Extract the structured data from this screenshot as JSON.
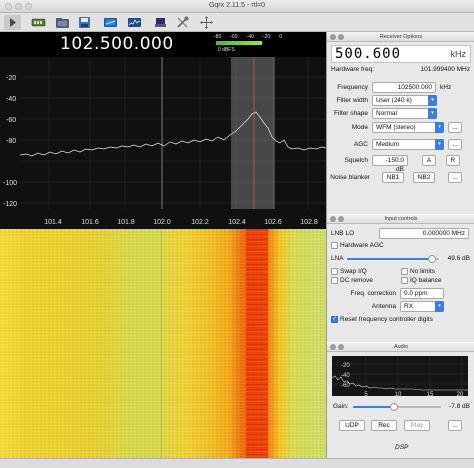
{
  "window": {
    "title": "Gqrx 2.11.5 - rtl=0"
  },
  "toolbar": {
    "icons": [
      "play-icon",
      "device-icon",
      "open-icon",
      "save-icon",
      "receiver-icon",
      "fft-settings-icon",
      "tools-icon",
      "move-icon"
    ]
  },
  "main": {
    "frequency_display": "102.500.000",
    "meter": {
      "ticks": [
        "-80",
        "-60",
        "-40",
        "-20",
        "0"
      ],
      "label": "0 dBFS",
      "level_fraction": 0.72
    },
    "plot": {
      "y_ticks": [
        "-20",
        "-40",
        "-60",
        "-80",
        "-100",
        "-120"
      ],
      "x_ticks": [
        "101.4",
        "101.6",
        "101.8",
        "102.0",
        "102.2",
        "102.4",
        "102.6",
        "102.8"
      ]
    }
  },
  "receiver": {
    "title": "Receiver Options",
    "lcd_digits": "500.600",
    "lcd_unit": "kHz",
    "hw_freq_label": "Hardware freq:",
    "hw_freq_value": "101.999400 MHz",
    "frequency_label": "Frequency",
    "frequency_value": "102500.000",
    "frequency_unit": "kHz",
    "filter_width_label": "Filter width",
    "filter_width_value": "User (240 k)",
    "filter_shape_label": "Filter shape",
    "filter_shape_value": "Normal",
    "mode_label": "Mode",
    "mode_value": "WFM (stereo)",
    "mode_opts": "...",
    "agc_label": "AGC",
    "agc_value": "Medium",
    "agc_opts": "...",
    "squelch_label": "Squelch",
    "squelch_value": "-150.0 dB",
    "squelch_a": "A",
    "squelch_r": "R",
    "noise_blanker_label": "Noise blanker",
    "nb1": "NB1",
    "nb2": "NB2",
    "nb_opts": "..."
  },
  "input": {
    "title": "Input controls",
    "lnb_label": "LNB LO",
    "lnb_value": "0.000000 MHz",
    "hw_agc_label": "Hardware AGC",
    "lna_label": "LNA",
    "lna_value": "49.6 dB",
    "lna_fraction": 0.92,
    "swap_iq_label": "Swap I/Q",
    "no_limits_label": "No limits",
    "dc_remove_label": "DC remove",
    "iq_balance_label": "IQ balance",
    "freq_corr_label": "Freq. correction",
    "freq_corr_value": "0.0 ppm",
    "antenna_label": "Antenna",
    "antenna_value": "RX",
    "reset_label": "Reset frequency controller digits"
  },
  "audio": {
    "title": "Audio",
    "fft_y_ticks": [
      "-20",
      "-40",
      "-60"
    ],
    "fft_x_ticks": [
      "5",
      "10",
      "15",
      "20"
    ],
    "gain_label": "Gain:",
    "gain_value": "-7.8 dB",
    "gain_fraction": 0.47,
    "udp": "UDP",
    "rec": "Rec",
    "play": "Play",
    "opts": "...",
    "dsp": "DSP"
  }
}
